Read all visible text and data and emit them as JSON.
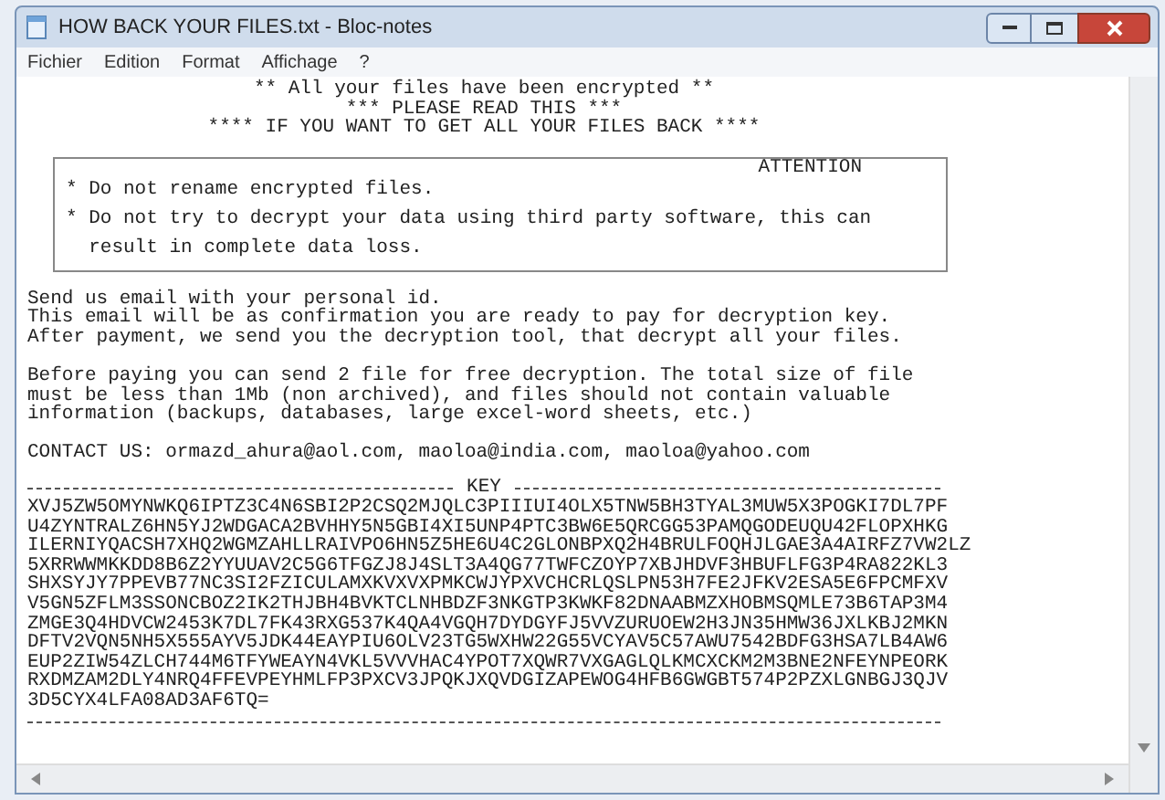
{
  "window": {
    "title": "HOW BACK YOUR FILES.txt - Bloc-notes"
  },
  "menu": [
    "Fichier",
    "Edition",
    "Format",
    "Affichage",
    "?"
  ],
  "document": {
    "header": [
      "** All your files have been encrypted **",
      "*** PLEASE READ THIS ***",
      "**** IF YOU WANT TO GET ALL YOUR FILES BACK ****"
    ],
    "attention": {
      "title": "ATTENTION",
      "lines": [
        "* Do not rename encrypted files.",
        "* Do not try to decrypt your data using third party software, this can",
        "  result in complete data loss."
      ]
    },
    "paragraphs": [
      [
        "Send us email with your personal id.",
        "This email will be as confirmation you are ready to pay for decryption key.",
        "After payment, we send you the decryption tool, that decrypt all your files."
      ],
      [
        "Before paying you can send 2 file for free decryption. The total size of file",
        "must be less than 1Mb (non archived), and files should not contain valuable",
        "information (backups, databases, large excel-word sheets, etc.)"
      ],
      [
        "CONTACT US: ormazd_ahura@aol.com, maoloa@india.com, maoloa@yahoo.com"
      ]
    ],
    "key": {
      "title": "KEY",
      "lines": [
        "XVJ5ZW5OMYNWKQ6IPTZ3C4N6SBI2P2CSQ2MJQLC3PIIIUI4OLX5TNW5BH3TYAL3MUW5X3POGKI7DL7PF",
        "U4ZYNTRALZ6HN5YJ2WDGACA2BVHHY5N5GBI4XI5UNP4PTC3BW6E5QRCGG53PAMQGODEUQU42FLOPXHKG",
        "ILERNIYQACSH7XHQ2WGMZAHLLRAIVPO6HN5Z5HE6U4C2GLONBPXQ2H4BRULFOQHJLGAE3A4AIRFZ7VW2LZ",
        "5XRRWWMKKDD8B6Z2YYUUAV2C5G6TFGZJ8J4SLT3A4QG77TWFCZOYP7XBJHDVF3HBUFLFG3P4RA822KL3",
        "SHXSYJY7PPEVB77NC3SI2FZICULAMXKVXVXPMKCWJYPXVCHCRLQSLPN53H7FE2JFKV2ESA5E6FPCMFXV",
        "V5GN5ZFLM3SSONCBOZ2IK2THJBH4BVKTCLNHBDZF3NKGTP3KWKF82DNAABMZXHOBMSQMLE73B6TAP3M4",
        "ZMGE3Q4HDVCW2453K7DL7FK43RXG537K4QA4VGQH7DYDGYFJ5VVZURUOEW2H3JN35HMW36JXLKBJ2MKN",
        "DFTV2VQN5NH5X555AYV5JDK44EAYPIU6OLV23TG5WXHW22G55VCYAV5C57AWU7542BDFG3HSA7LB4AW6",
        "EUP2ZIW54ZLCH744M6TFYWEAYN4VKL5VVVHAC4YPOT7XQWR7VXGAGLQLKMCXCKM2M3BNE2NFEYNPEORK",
        "RXDMZAM2DLY4NRQ4FFEVPEYHMLFP3PXCV3JPQKJXQVDGIZAPEWOG4HFB6GWGBT574P2PZXLGNBGJ3QJV",
        "3D5CYX4LFA08AD3AF6TQ="
      ]
    }
  }
}
